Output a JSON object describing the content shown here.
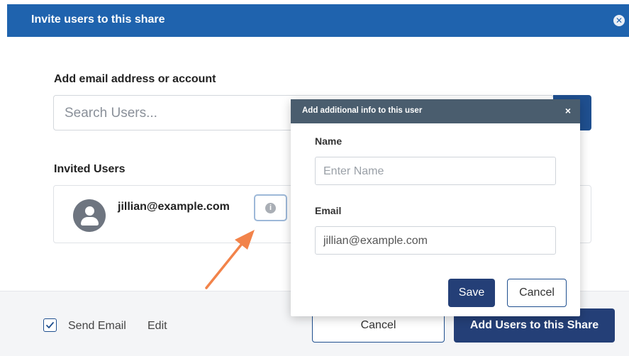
{
  "modal": {
    "title": "Invite users to this share",
    "close_icon": "close-circle-icon"
  },
  "add_section": {
    "label": "Add email address or account",
    "search_placeholder": "Search Users..."
  },
  "invited_section": {
    "label": "Invited Users",
    "users": [
      {
        "email": "jillian@example.com",
        "avatar_icon": "user-avatar-icon",
        "info_icon": "info-icon"
      }
    ]
  },
  "footer": {
    "send_email": {
      "label": "Send Email",
      "checked": true
    },
    "edit_label": "Edit",
    "cancel_label": "Cancel",
    "add_label": "Add Users to this Share"
  },
  "popup": {
    "title": "Add additional info to this user",
    "close_glyph": "×",
    "name_label": "Name",
    "name_placeholder": "Enter Name",
    "email_label": "Email",
    "email_value": "jillian@example.com",
    "save_label": "Save",
    "cancel_label": "Cancel"
  },
  "colors": {
    "header": "#1f63ae",
    "primary_button": "#243f77",
    "popup_header": "#4a5d6e",
    "annotation_arrow": "#f2834a"
  }
}
